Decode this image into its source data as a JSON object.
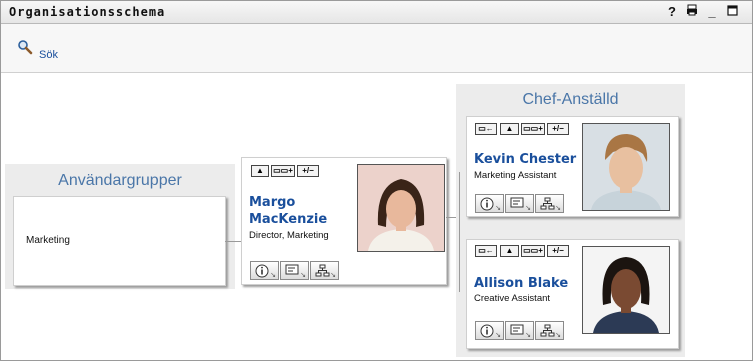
{
  "window": {
    "title": "Organisationsschema",
    "controls": {
      "help": "?",
      "print": "print-icon",
      "minimize": "_",
      "maximize": "maximize-icon"
    }
  },
  "toolbar": {
    "search_label": "Sök",
    "search_icon": "magnifier-icon"
  },
  "panels": {
    "groups": {
      "title": "Användargrupper",
      "items": [
        "Marketing"
      ]
    },
    "manager_employee": {
      "title": "Chef-Anställd"
    }
  },
  "people": {
    "margo": {
      "name_line1": "Margo",
      "name_line2": "MacKenzie",
      "job": "Director, Marketing"
    },
    "kevin": {
      "name": "Kevin Chester",
      "job": "Marketing Assistant"
    },
    "allison": {
      "name": "Allison Blake",
      "job": "Creative Assistant"
    }
  },
  "card_buttons": {
    "up": "▲",
    "reports_add": "▭▭+",
    "toggle": "+/−",
    "assign": "▭←"
  },
  "colors": {
    "accent_title": "#4a76a8",
    "link": "#1a4f9c",
    "panel_bg": "#ececec"
  }
}
